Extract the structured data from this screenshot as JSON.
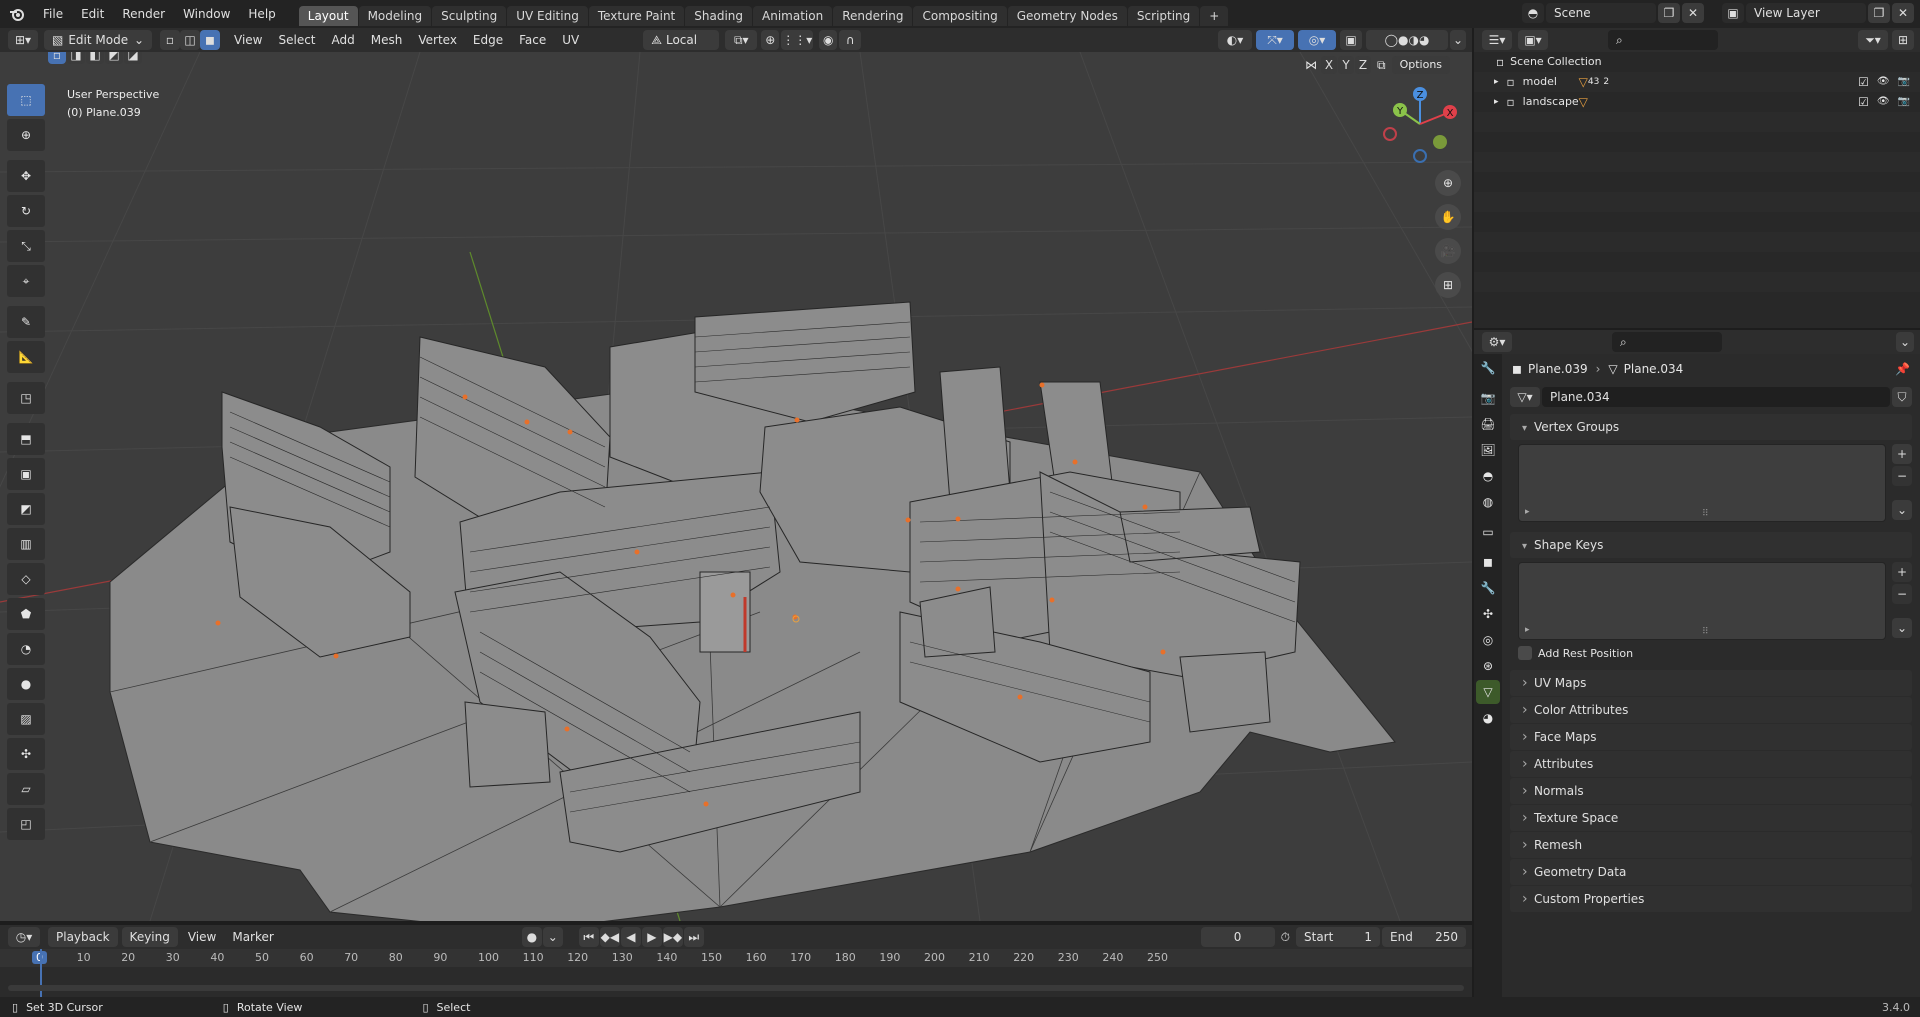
{
  "topbar": {
    "menu": [
      "File",
      "Edit",
      "Render",
      "Window",
      "Help"
    ],
    "workspaces": [
      "Layout",
      "Modeling",
      "Sculpting",
      "UV Editing",
      "Texture Paint",
      "Shading",
      "Animation",
      "Rendering",
      "Compositing",
      "Geometry Nodes",
      "Scripting"
    ],
    "active_workspace": "Layout",
    "add_tab": "+",
    "scene": "Scene",
    "view_layer": "View Layer"
  },
  "viewport_header": {
    "mode": "Edit Mode",
    "menus": [
      "View",
      "Select",
      "Add",
      "Mesh",
      "Vertex",
      "Edge",
      "Face",
      "UV"
    ],
    "orientation": "Local",
    "options": "Options",
    "axes": [
      "X",
      "Y",
      "Z"
    ]
  },
  "viewport": {
    "perspective": "User Perspective",
    "object": "(0) Plane.039",
    "gizmo": {
      "z": "Z",
      "y": "Y",
      "x": "X"
    }
  },
  "outliner": {
    "root": "Scene Collection",
    "items": [
      {
        "name": "model",
        "badge": "43",
        "badge2": "2"
      },
      {
        "name": "landscape",
        "badge": "",
        "badge2": ""
      }
    ]
  },
  "properties": {
    "object_name": "Plane.039",
    "mesh_name": "Plane.034",
    "data_field": "Plane.034",
    "vertex_groups": "Vertex Groups",
    "shape_keys": "Shape Keys",
    "add_rest_position": "Add Rest Position",
    "collapsed_panels": [
      "UV Maps",
      "Color Attributes",
      "Face Maps",
      "Attributes",
      "Normals",
      "Texture Space",
      "Remesh",
      "Geometry Data",
      "Custom Properties"
    ]
  },
  "timeline": {
    "menus": [
      "Playback",
      "Keying",
      "View",
      "Marker"
    ],
    "current_frame": "0",
    "start_label": "Start",
    "start": "1",
    "end_label": "End",
    "end": "250",
    "ticks": [
      "0",
      "10",
      "20",
      "30",
      "40",
      "50",
      "60",
      "70",
      "80",
      "90",
      "100",
      "110",
      "120",
      "130",
      "140",
      "150",
      "160",
      "170",
      "180",
      "190",
      "200",
      "210",
      "220",
      "230",
      "240",
      "250"
    ]
  },
  "statusbar": {
    "hint1": "Set 3D Cursor",
    "hint2": "Rotate View",
    "hint3": "Select",
    "version": "3.4.0"
  },
  "colors": {
    "accent": "#4772b3",
    "x_axis": "#e0404a",
    "y_axis": "#8bc34a",
    "z_axis": "#4a8fe0",
    "mesh_face": "#8a8a8a",
    "mesh_wire": "#2a2a2a",
    "vertex": "#e8702a"
  }
}
